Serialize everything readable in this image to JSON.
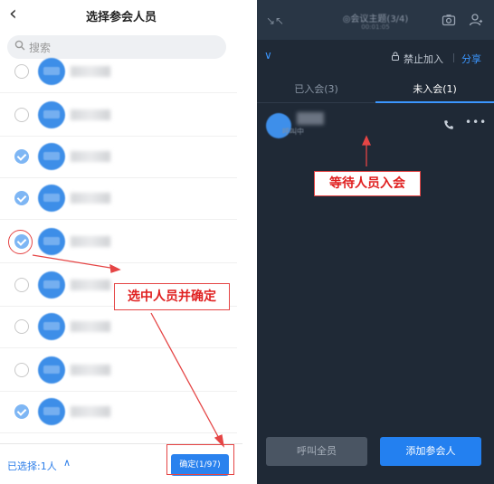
{
  "left_panel": {
    "title": "选择参会人员",
    "back_icon": "chevron-left-icon",
    "search": {
      "placeholder": "搜索",
      "icon": "search-icon"
    },
    "contacts": [
      {
        "checked": false
      },
      {
        "checked": false
      },
      {
        "checked": true
      },
      {
        "checked": true
      },
      {
        "checked": true
      },
      {
        "checked": false
      },
      {
        "checked": false
      },
      {
        "checked": false
      },
      {
        "checked": true
      }
    ],
    "selected_text": "已选择:1人",
    "expand_icon": "chevron-up-icon",
    "confirm_label": "确定(1/97)"
  },
  "right_panel": {
    "meeting_title": "◎会议主题(3/4)",
    "meeting_subtitle": "00:01:05",
    "forbid_join": "禁止加入",
    "share": "分享",
    "tabs": [
      {
        "label": "已入会(3)",
        "active": false
      },
      {
        "label": "未入会(1)",
        "active": true
      }
    ],
    "participant_status": "呼叫中",
    "call_all_label": "呼叫全员",
    "add_participant_label": "添加参会人"
  },
  "annotations": {
    "left": "选中人员并确定",
    "right": "等待人员入会"
  },
  "colors": {
    "accent_blue": "#2a82ee",
    "annotation_red": "#e54545",
    "dark_bg": "#1f2936"
  }
}
